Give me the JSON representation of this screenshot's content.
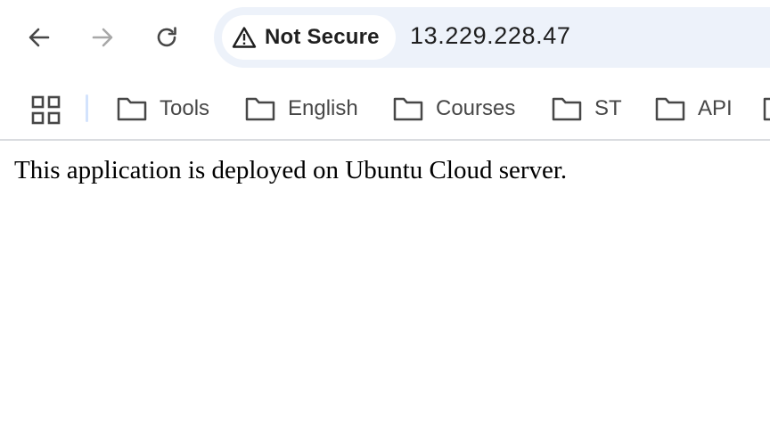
{
  "toolbar": {
    "back_icon": "arrow-left-icon",
    "forward_icon": "arrow-right-icon",
    "reload_icon": "reload-icon"
  },
  "omnibox": {
    "security_icon": "warning-triangle-icon",
    "security_label": "Not Secure",
    "url": "13.229.228.47"
  },
  "bookmarks": {
    "apps_icon": "apps-grid-icon",
    "items": [
      {
        "label": "Tools",
        "icon": "folder-icon"
      },
      {
        "label": "English",
        "icon": "folder-icon"
      },
      {
        "label": "Courses",
        "icon": "folder-icon"
      },
      {
        "label": "ST",
        "icon": "folder-icon"
      },
      {
        "label": "API",
        "icon": "folder-icon"
      }
    ]
  },
  "page": {
    "body_text": "This application is deployed on Ubuntu Cloud server."
  },
  "colors": {
    "omnibox_bg": "#edf2fa",
    "icon": "#474747",
    "icon_disabled": "#a8a8a8",
    "divider": "#dadce0"
  }
}
